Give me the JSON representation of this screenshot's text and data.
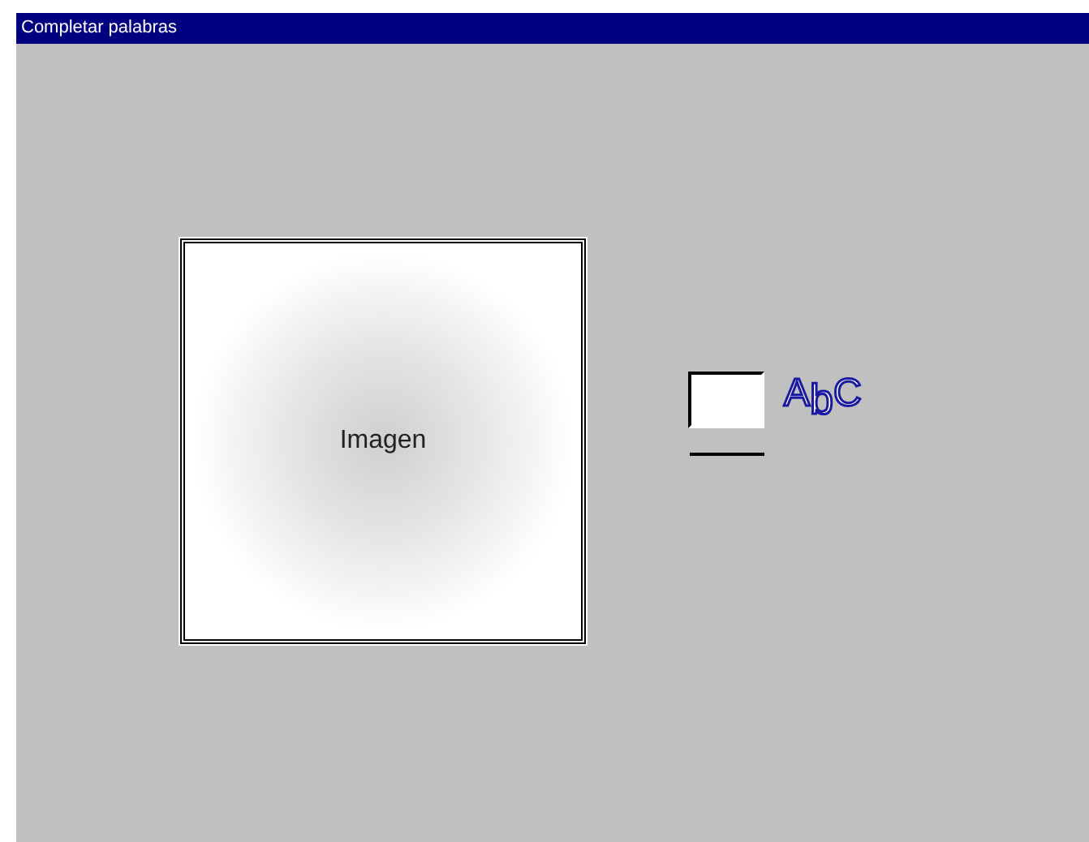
{
  "window": {
    "title": "Completar palabras"
  },
  "image": {
    "label": "Imagen"
  },
  "logo": {
    "text": "A$_{b}$C"
  }
}
